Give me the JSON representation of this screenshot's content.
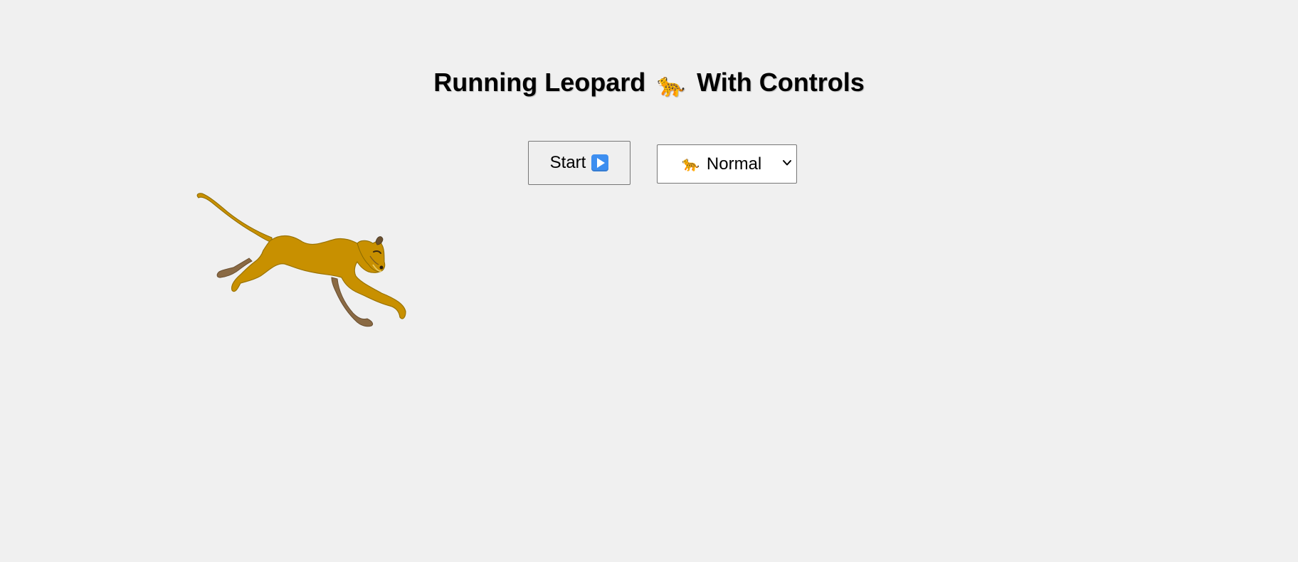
{
  "page": {
    "title_prefix": "Running Leopard",
    "title_emoji": "🐆",
    "title_suffix": "With Controls"
  },
  "controls": {
    "start_label": "Start",
    "start_icon": "play-button-icon",
    "speed_select": {
      "emoji": "🐆",
      "selected": "Normal"
    }
  },
  "colors": {
    "background": "#f0f0f0",
    "leopard_body": "#c89000",
    "leopard_far_legs": "#8a6a44",
    "play_icon": "#3d8ef0"
  }
}
